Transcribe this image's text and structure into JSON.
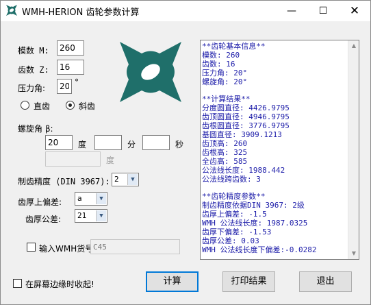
{
  "window": {
    "title": "WMH-HERION 齿轮参数计算",
    "min_glyph": "—",
    "max_glyph": "☐",
    "close_glyph": "✕"
  },
  "form": {
    "module_label": "模数 M:",
    "module_value": "260",
    "teeth_label": "齿数 Z:",
    "teeth_value": "16",
    "pressure_label": "压力角:",
    "pressure_value": "20",
    "pressure_unit": "°",
    "radio_spur_label": "直齿",
    "radio_helical_label": "斜齿",
    "helix_label": "螺旋角 β:",
    "helix_deg_value": "20",
    "helix_deg_unit": "度",
    "helix_min_value": "",
    "helix_min_unit": "分",
    "helix_sec_value": "",
    "helix_sec_unit": "秒",
    "helix_total_value": "",
    "helix_total_unit": "度",
    "precision_label": "制齿精度 (DIN 3967):",
    "precision_value": "2",
    "upper_dev_label": "齿厚上偏差:",
    "upper_dev_value": "a",
    "tolerance_label": "齿厚公差:",
    "tolerance_value": "21",
    "wmh_checkbox_label": "输入WMH货号",
    "wmh_placeholder": "C45",
    "collapse_checkbox_label": "在屏幕边缘时收起!"
  },
  "results_text": "**齿轮基本信息**\n模数: 260\n齿数: 16\n压力角: 20°\n螺旋角: 20°\n\n**计算结果**\n分度圆直径: 4426.9795\n齿顶圆直径: 4946.9795\n齿根圆直径: 3776.9795\n基圆直径: 3909.1213\n齿顶高: 260\n齿根高: 325\n全齿高: 585\n公法线长度: 1988.442\n公法线跨齿数: 3\n\n**齿轮精度参数**\n制齿精度依据DIN 3967: 2级\n齿厚上偏差: -1.5\nWMH 公法线长度: 1987.0325\n齿厚下偏差: -1.53\n齿厚公差: 0.03\nWMH 公法线长度下偏差:-0.0282",
  "buttons": {
    "calculate": "计算",
    "print": "打印结果",
    "exit": "退出"
  },
  "icons": {
    "app_icon": "herion-logo-icon",
    "dropdown": "▼",
    "scroll_up": "▲",
    "scroll_down": "▼"
  },
  "colors": {
    "logo": "#1f6f6a",
    "results_text": "#1a1aa8",
    "default_button_border": "#0078d7"
  }
}
